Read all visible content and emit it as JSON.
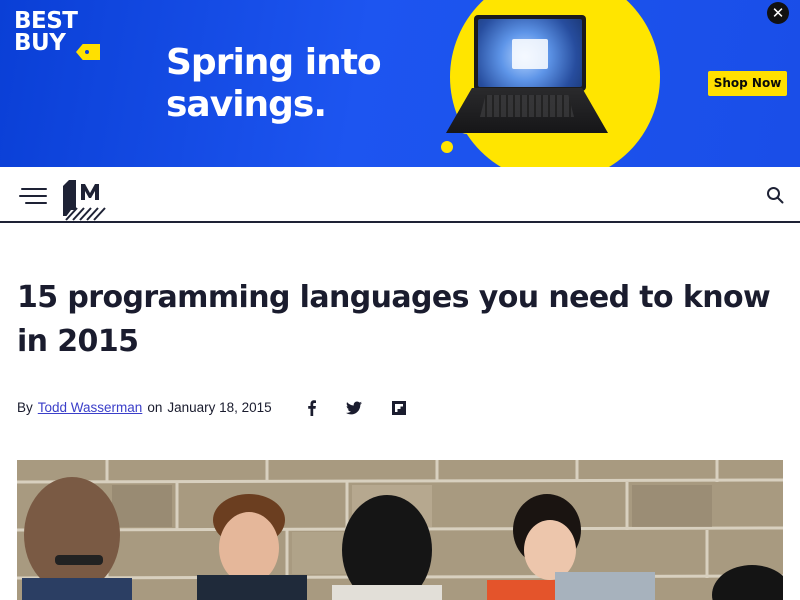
{
  "ad": {
    "logo_line1": "BEST",
    "logo_line2": "BUY",
    "headline_line1": "Spring into",
    "headline_line2": "savings.",
    "cta": "Shop Now",
    "close_symbol": "✕",
    "colors": {
      "background": "#1a4ee8",
      "accent": "#ffe000"
    }
  },
  "header": {
    "menu_icon": "hamburger-menu-icon",
    "logo_icon": "mashable-m-logo",
    "search_icon": "search-icon",
    "accent_color": "#1e2235"
  },
  "article": {
    "title": "15 programming languages you need to know in 2015",
    "byline": {
      "prefix": "By",
      "author": "Todd Wasserman",
      "date_prefix": "on",
      "date": "January 18, 2015"
    },
    "share": [
      {
        "icon": "facebook-icon"
      },
      {
        "icon": "twitter-icon"
      },
      {
        "icon": "flipboard-icon"
      }
    ],
    "hero_image": {
      "description_icon": "hero-photo"
    },
    "link_color": "#3b3fc9"
  }
}
